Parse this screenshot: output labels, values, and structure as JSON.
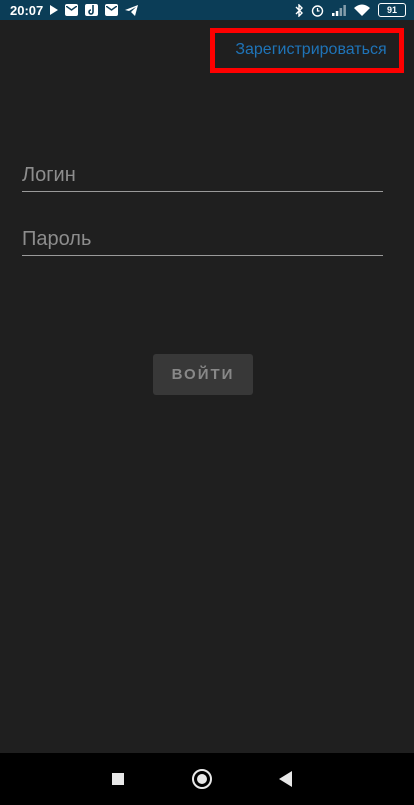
{
  "status_bar": {
    "time": "20:07",
    "battery": "91",
    "left_icons": [
      "play-icon",
      "mail-icon",
      "music-icon",
      "mail-icon",
      "telegram-icon"
    ],
    "right_icons": [
      "bluetooth-icon",
      "alarm-icon",
      "signal-icon",
      "wifi-icon"
    ],
    "background": "#0b3d57"
  },
  "header": {
    "register_label": "Зарегистрироваться"
  },
  "form": {
    "login_placeholder": "Логин",
    "login_value": "",
    "password_placeholder": "Пароль",
    "password_value": "",
    "submit_label": "ВОЙТИ"
  },
  "colors": {
    "background": "#1f1f1f",
    "accent_link": "#1f74b8",
    "highlight": "#ff0000",
    "button_bg": "#383838",
    "button_text": "#888888"
  },
  "nav_bar": {
    "buttons": [
      "recent-apps",
      "home",
      "back"
    ]
  }
}
